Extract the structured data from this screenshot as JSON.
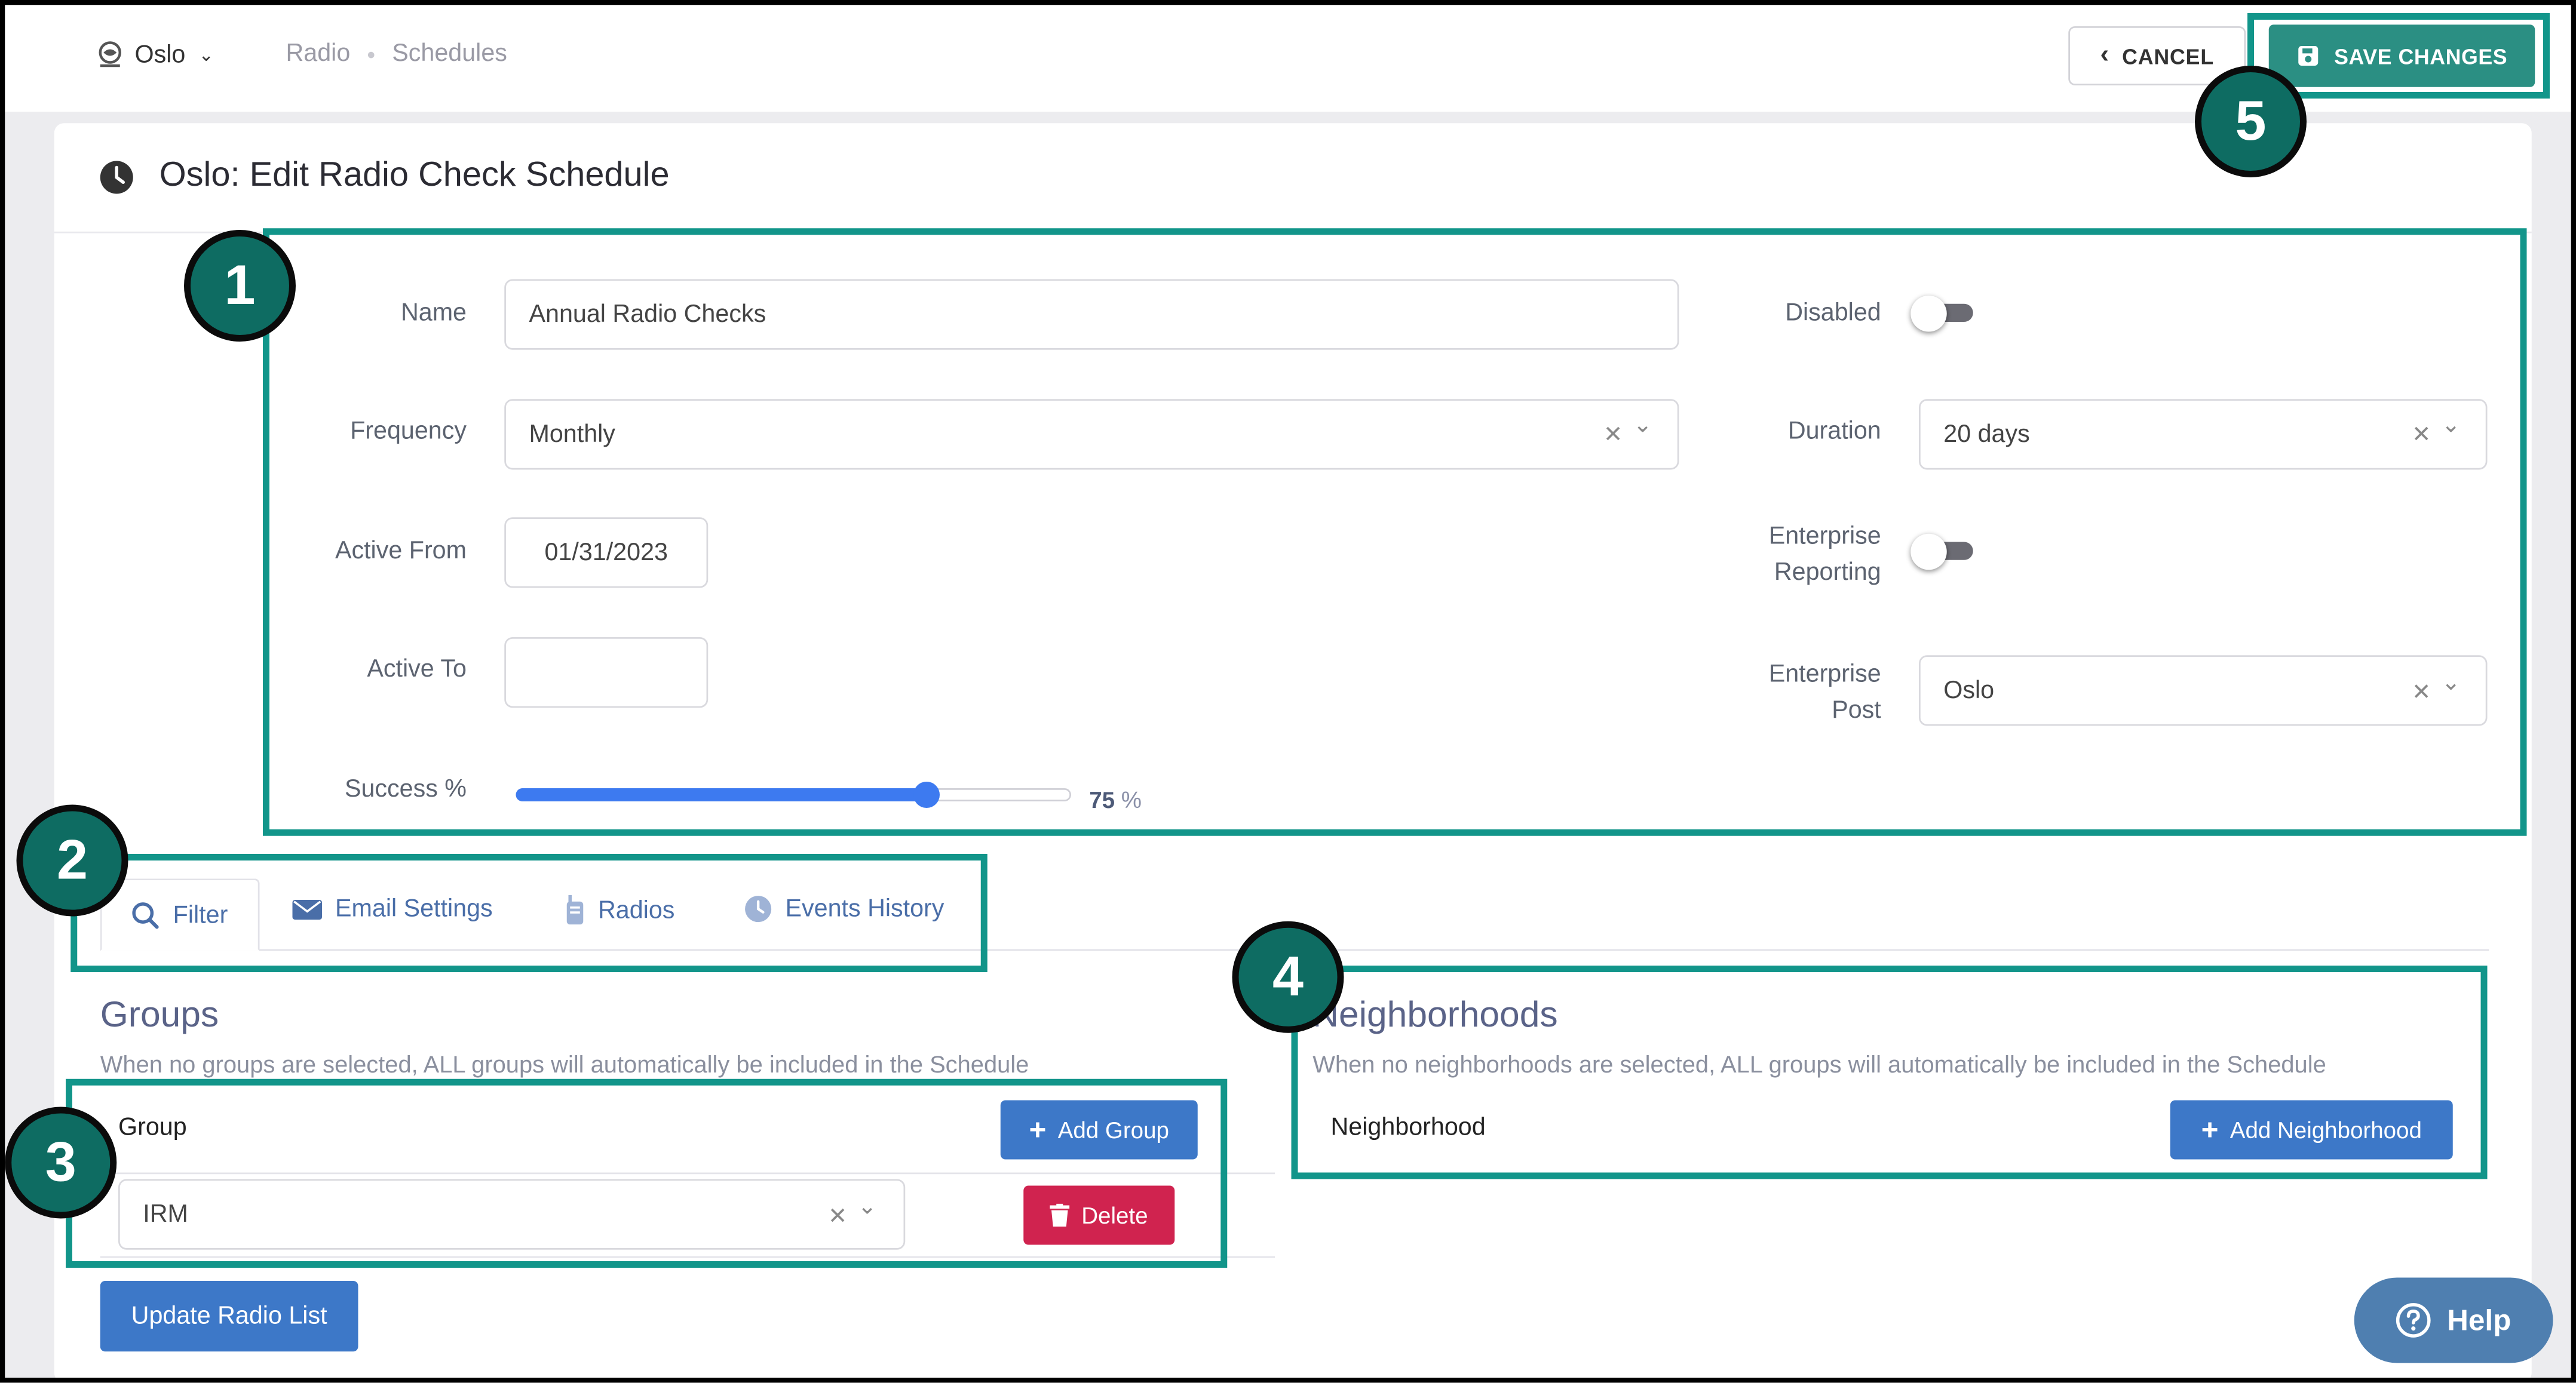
{
  "topbar": {
    "location": "Oslo",
    "breadcrumb": [
      "Radio",
      "Schedules"
    ],
    "cancel_label": "CANCEL",
    "save_label": "SAVE CHANGES"
  },
  "page": {
    "title": "Oslo: Edit Radio Check Schedule"
  },
  "form": {
    "name_label": "Name",
    "name_value": "Annual Radio Checks",
    "frequency_label": "Frequency",
    "frequency_value": "Monthly",
    "active_from_label": "Active From",
    "active_from_value": "01/31/2023",
    "active_to_label": "Active To",
    "active_to_value": "",
    "success_label": "Success %",
    "success_value": "75",
    "success_unit": "%",
    "success_fraction": 0.75,
    "disabled_label": "Disabled",
    "disabled_on": false,
    "duration_label": "Duration",
    "duration_value": "20 days",
    "enterprise_reporting_label_1": "Enterprise",
    "enterprise_reporting_label_2": "Reporting",
    "enterprise_reporting_on": false,
    "enterprise_post_label_1": "Enterprise",
    "enterprise_post_label_2": "Post",
    "enterprise_post_value": "Oslo"
  },
  "tabs": [
    {
      "label": "Filter",
      "icon": "search-icon",
      "active": true
    },
    {
      "label": "Email Settings",
      "icon": "envelope-icon",
      "active": false
    },
    {
      "label": "Radios",
      "icon": "radio-icon",
      "active": false
    },
    {
      "label": "Events History",
      "icon": "clock-icon",
      "active": false
    }
  ],
  "groups": {
    "title": "Groups",
    "hint": "When no groups are selected, ALL groups will automatically be included in the Schedule",
    "column_label": "Group",
    "add_label": "Add Group",
    "row_value": "IRM",
    "delete_label": "Delete"
  },
  "neighborhoods": {
    "title": "Neighborhoods",
    "hint": "When no neighborhoods are selected, ALL groups will automatically be included in the Schedule",
    "column_label": "Neighborhood",
    "add_label": "Add Neighborhood"
  },
  "update_radio_label": "Update Radio List",
  "help_label": "Help",
  "callouts": [
    "1",
    "2",
    "3",
    "4",
    "5"
  ],
  "colors": {
    "teal": "#12958a",
    "badge": "#0e6c62",
    "primary": "#3d78c8",
    "danger": "#d0234f",
    "save": "#2b8f83"
  }
}
